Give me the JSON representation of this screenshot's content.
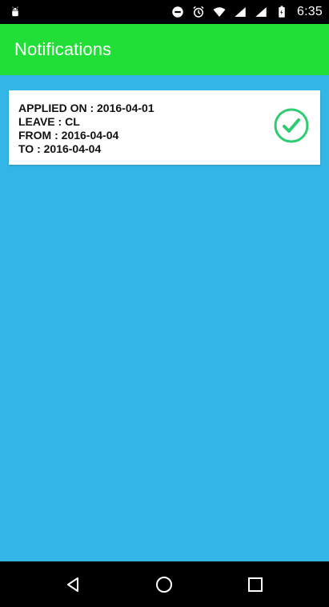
{
  "status_bar": {
    "time": "6:35",
    "left_icon": "android-icon",
    "icons": [
      "do-not-disturb-icon",
      "alarm-icon",
      "wifi-icon",
      "signal-icon",
      "signal-icon",
      "battery-icon"
    ]
  },
  "app_bar": {
    "title": "Notifications",
    "background": "#22df37"
  },
  "content": {
    "background": "#33b5e5"
  },
  "notifications": [
    {
      "lines": [
        "APPLIED ON : 2016-04-01",
        "LEAVE : CL",
        "FROM : 2016-04-04",
        "TO : 2016-04-04"
      ],
      "status_icon": "check-circle-icon",
      "status_color": "#2ecc71"
    }
  ],
  "nav_bar": {
    "buttons": [
      "back-icon",
      "home-icon",
      "recents-icon"
    ]
  }
}
